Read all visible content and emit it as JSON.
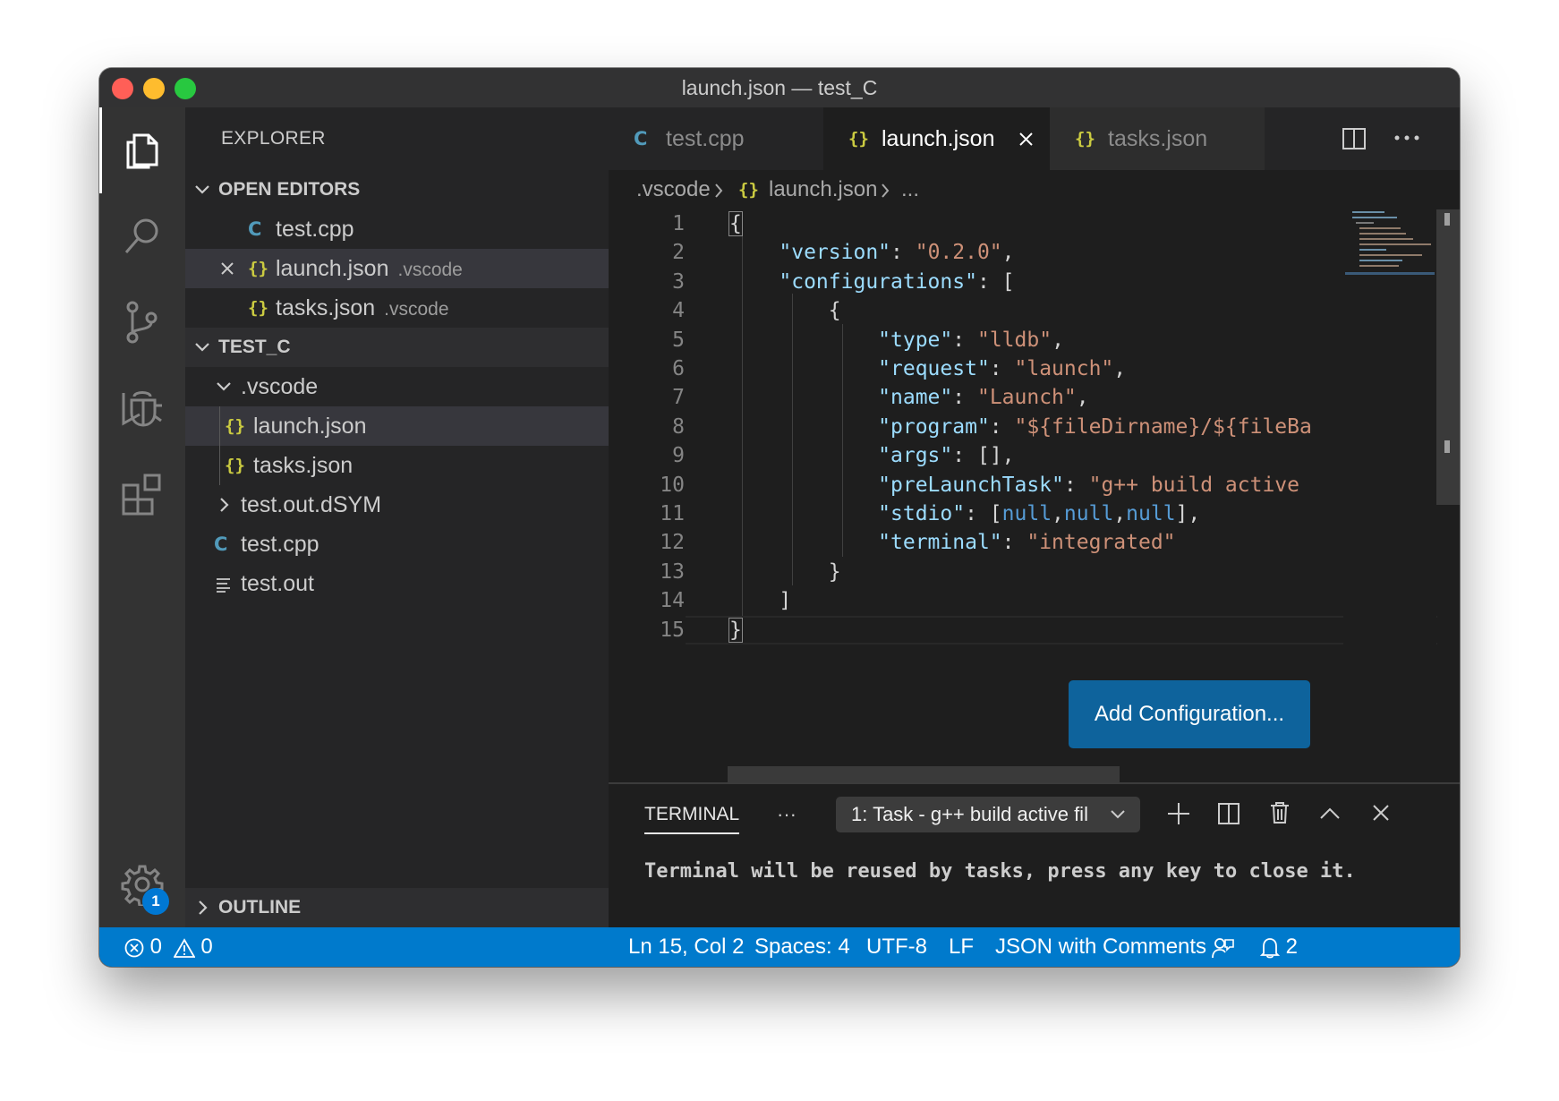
{
  "window": {
    "title": "launch.json — test_C"
  },
  "activity_bar": {
    "items": [
      "explorer",
      "search",
      "source-control",
      "run-debug",
      "extensions"
    ],
    "settings_badge": "1"
  },
  "sidebar": {
    "title": "EXPLORER",
    "open_editors": {
      "header": "OPEN EDITORS",
      "items": [
        {
          "name": "test.cpp",
          "desc": ""
        },
        {
          "name": "launch.json",
          "desc": ".vscode"
        },
        {
          "name": "tasks.json",
          "desc": ".vscode"
        }
      ]
    },
    "project": {
      "header": "TEST_C",
      "tree": [
        {
          "name": ".vscode"
        },
        {
          "name": "launch.json"
        },
        {
          "name": "tasks.json"
        },
        {
          "name": "test.out.dSYM"
        },
        {
          "name": "test.cpp"
        },
        {
          "name": "test.out"
        }
      ]
    },
    "outline_header": "OUTLINE"
  },
  "tabs": [
    {
      "label": "test.cpp"
    },
    {
      "label": "launch.json"
    },
    {
      "label": "tasks.json"
    }
  ],
  "breadcrumb": {
    "folder": ".vscode",
    "file": "launch.json",
    "more": "..."
  },
  "editor": {
    "line_numbers": [
      "1",
      "2",
      "3",
      "4",
      "5",
      "6",
      "7",
      "8",
      "9",
      "10",
      "11",
      "12",
      "13",
      "14",
      "15"
    ],
    "code": {
      "open_brace": "{",
      "version_key": "\"version\"",
      "version_val": "\"0.2.0\"",
      "configurations_key": "\"configurations\"",
      "open_bracket": "[",
      "obj_open": "{",
      "type_key": "\"type\"",
      "type_val": "\"lldb\"",
      "request_key": "\"request\"",
      "request_val": "\"launch\"",
      "name_key": "\"name\"",
      "name_val": "\"Launch\"",
      "program_key": "\"program\"",
      "program_val": "\"${fileDirname}/${fileBa",
      "args_key": "\"args\"",
      "args_val": "[]",
      "prelaunch_key": "\"preLaunchTask\"",
      "prelaunch_val": "\"g++ build active",
      "stdio_key": "\"stdio\"",
      "stdio_null": "null",
      "terminal_key": "\"terminal\"",
      "terminal_val": "\"integrated\"",
      "obj_close": "}",
      "close_bracket": "]",
      "close_brace": "}"
    },
    "add_configuration_label": "Add Configuration..."
  },
  "panel": {
    "tab_label": "TERMINAL",
    "more_label": "···",
    "terminal_select": "1: Task - g++ build active fil",
    "terminal_text": "Terminal will be reused by tasks, press any key to close it."
  },
  "statusbar": {
    "errors": "0",
    "warnings": "0",
    "position": "Ln 15, Col 2",
    "spaces": "Spaces: 4",
    "encoding": "UTF-8",
    "eol": "LF",
    "language": "JSON with Comments",
    "notifications": "2"
  },
  "colors": {
    "accent": "#007acc",
    "button": "#0e639c",
    "json_brace_icon": "#cbcb41",
    "cpp_icon": "#519aba"
  }
}
